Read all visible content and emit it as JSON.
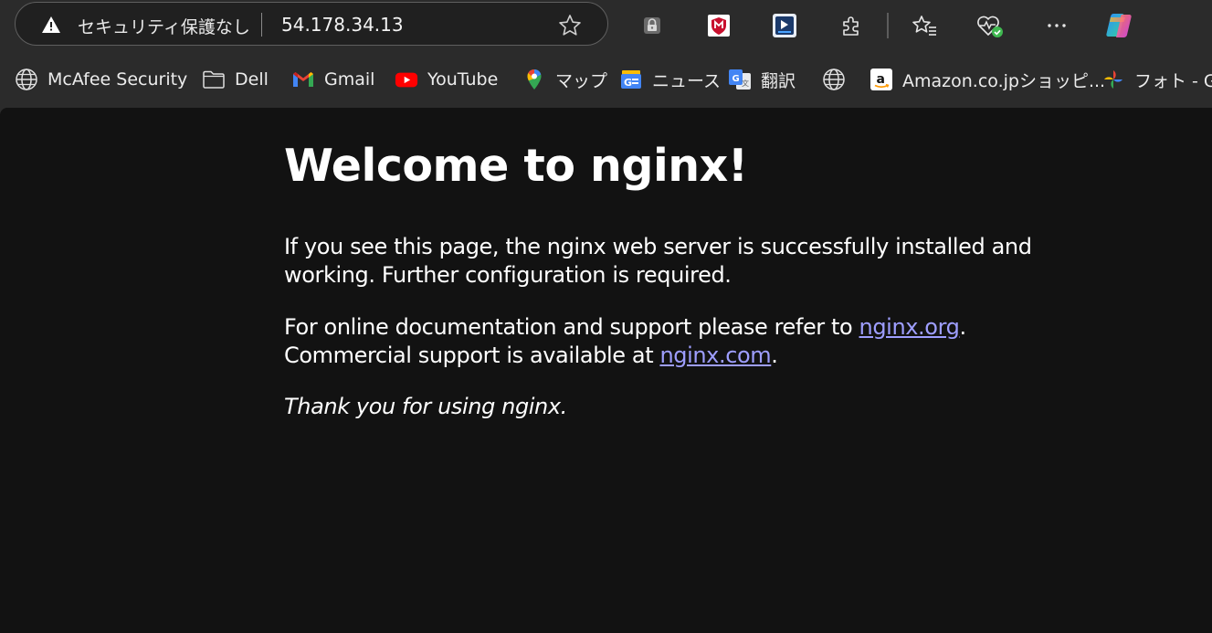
{
  "address_bar": {
    "security_label": "セキュリティ保護なし",
    "url": "54.178.34.13"
  },
  "toolbar_icons": [
    "password-lock-icon",
    "mcafee-extension-icon",
    "screencast-extension-icon",
    "extensions-puzzle-icon",
    "favorites-icon",
    "browser-essentials-icon",
    "more-menu-icon",
    "copilot-icon"
  ],
  "bookmarks": [
    {
      "label": "McAfee Security",
      "icon": "globe-icon"
    },
    {
      "label": "Dell",
      "icon": "folder-icon"
    },
    {
      "label": "Gmail",
      "icon": "gmail-icon"
    },
    {
      "label": "YouTube",
      "icon": "youtube-icon"
    },
    {
      "label": "マップ",
      "icon": "maps-pin-icon"
    },
    {
      "label": "ニュース",
      "icon": "news-icon"
    },
    {
      "label": "翻訳",
      "icon": "translate-icon"
    },
    {
      "label": "",
      "icon": "globe-icon"
    },
    {
      "label": "Amazon.co.jpショッピ...",
      "icon": "amazon-icon"
    },
    {
      "label": "フォト - Go",
      "icon": "photos-pinwheel-icon"
    }
  ],
  "page": {
    "title": "Welcome to nginx!",
    "para1": "If you see this page, the nginx web server is successfully installed and working. Further configuration is required.",
    "para2_before": "For online documentation and support please refer to ",
    "link1": "nginx.org",
    "para2_middle": ".",
    "para2_line2": "Commercial support is available at ",
    "link2": "nginx.com",
    "para2_end": ".",
    "para3": "Thank you for using nginx."
  },
  "colors": {
    "page_background": "#121212",
    "browser_chrome": "#2b2b2b",
    "link": "#9e9eff"
  }
}
